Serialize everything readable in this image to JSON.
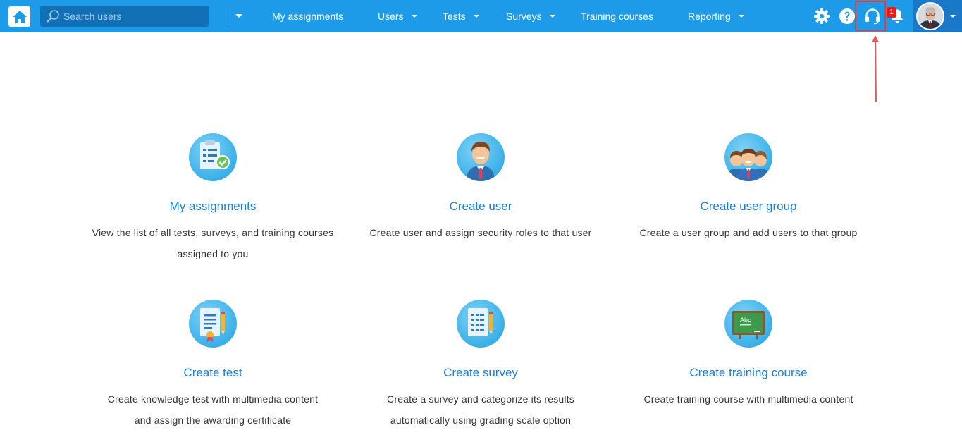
{
  "search": {
    "placeholder": "Search users"
  },
  "nav": [
    {
      "label": "My assignments",
      "has_dropdown": false
    },
    {
      "label": "Users",
      "has_dropdown": true
    },
    {
      "label": "Tests",
      "has_dropdown": true
    },
    {
      "label": "Surveys",
      "has_dropdown": true
    },
    {
      "label": "Training courses",
      "has_dropdown": false
    },
    {
      "label": "Reporting",
      "has_dropdown": true
    }
  ],
  "toolbar": {
    "icons": [
      "gear-icon",
      "help-icon",
      "headset-icon",
      "bell-icon"
    ],
    "notifications_count": "1",
    "highlight_color": "#e63b3b"
  },
  "cards": [
    {
      "icon": "clipboard-check-icon",
      "title": "My assignments",
      "desc_line1": "View the list of all tests, surveys, and training courses",
      "desc_line2": "assigned to you"
    },
    {
      "icon": "user-icon",
      "title": "Create user",
      "desc_line1": "Create user and assign security roles to that user",
      "desc_line2": ""
    },
    {
      "icon": "user-group-icon",
      "title": "Create user group",
      "desc_line1": "Create a user group and add users to that group",
      "desc_line2": ""
    },
    {
      "icon": "test-document-icon",
      "title": "Create test",
      "desc_line1": "Create knowledge test with multimedia content",
      "desc_line2": "and assign the awarding certificate"
    },
    {
      "icon": "survey-document-icon",
      "title": "Create survey",
      "desc_line1": "Create a survey and categorize its results",
      "desc_line2": "automatically using grading scale option"
    },
    {
      "icon": "chalkboard-icon",
      "title": "Create training course",
      "desc_line1": "Create training course with multimedia content",
      "desc_line2": "",
      "board_text": "Abc"
    }
  ],
  "colors": {
    "topbar": "#1e9be8",
    "search_bg": "#1270b6",
    "link": "#1d7fd0",
    "text": "#333333"
  }
}
